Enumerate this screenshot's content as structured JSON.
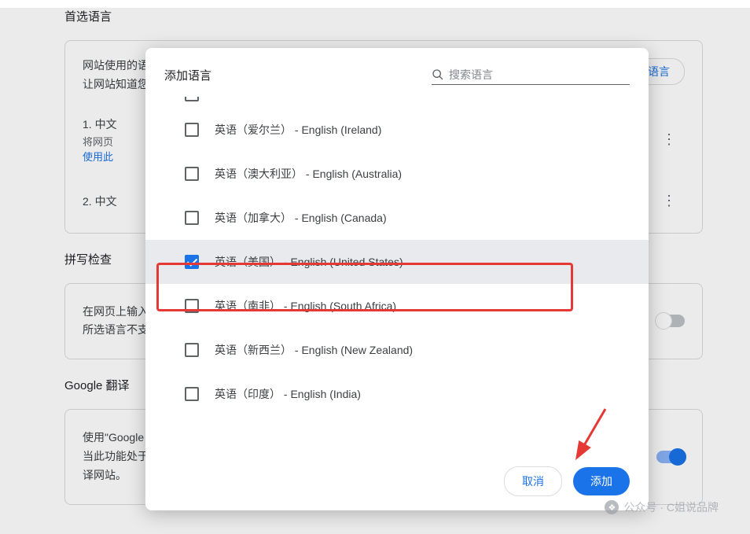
{
  "sections": {
    "preferred_title": "首选语言",
    "spellcheck_title": "拼写检查",
    "translate_title": "Google 翻译"
  },
  "card1": {
    "line1": "网站使用的语",
    "line2": "让网站知道您",
    "add_button": "加语言",
    "item1_title": "1. 中文",
    "item1_sub": "将网页",
    "item1_link": "使用此",
    "item2_title": "2. 中文"
  },
  "card2": {
    "line1": "在网页上输入",
    "line2": "所选语言不支"
  },
  "card3": {
    "line1": "使用\"Google",
    "line2": "当此功能处于",
    "line3": "译网站。"
  },
  "dialog": {
    "title": "添加语言",
    "search_placeholder": "搜索语言",
    "cancel": "取消",
    "add": "添加",
    "rows": [
      {
        "label": "英语（爱尔兰） - English (Ireland)",
        "checked": false,
        "selected": false
      },
      {
        "label": "英语（澳大利亚） - English (Australia)",
        "checked": false,
        "selected": false
      },
      {
        "label": "英语（加拿大） - English (Canada)",
        "checked": false,
        "selected": false
      },
      {
        "label": "英语（美国） - English (United States)",
        "checked": true,
        "selected": true
      },
      {
        "label": "英语（南非） - English (South Africa)",
        "checked": false,
        "selected": false
      },
      {
        "label": "英语（新西兰） - English (New Zealand)",
        "checked": false,
        "selected": false
      },
      {
        "label": "英语（印度） - English (India)",
        "checked": false,
        "selected": false
      }
    ]
  },
  "watermark": "公众号 · C姐说品牌"
}
